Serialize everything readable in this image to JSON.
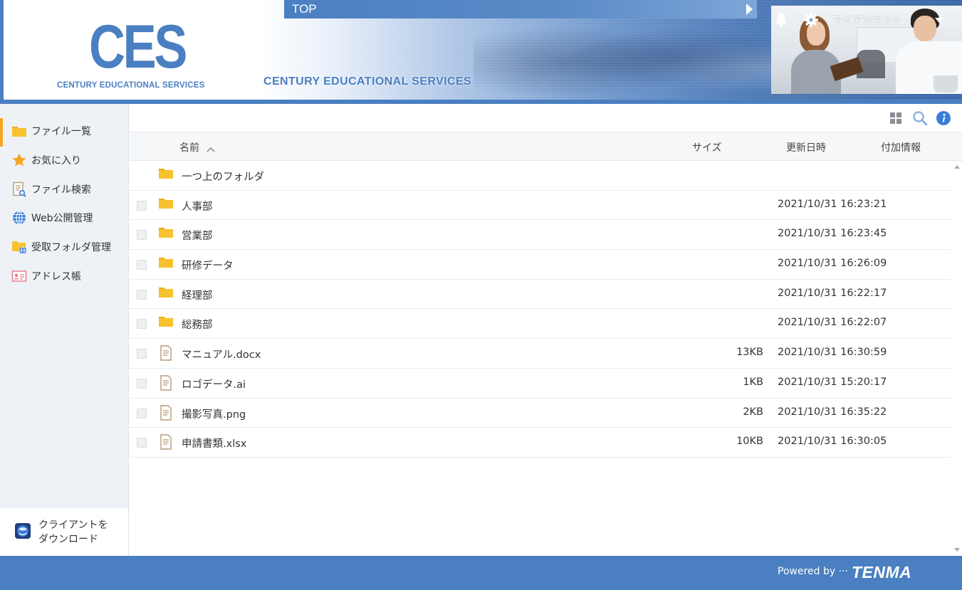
{
  "header": {
    "logo_text": "CES",
    "logo_subtitle": "CENTURY EDUCATIONAL SERVICES",
    "banner_title": "CENTURY EDUCATIONAL SERVICES",
    "breadcrumb": "TOP",
    "account_label": "マイアカウント"
  },
  "sidebar": {
    "items": [
      {
        "label": "ファイル一覧",
        "icon": "folder-icon"
      },
      {
        "label": "お気に入り",
        "icon": "star-icon"
      },
      {
        "label": "ファイル検索",
        "icon": "file-search-icon"
      },
      {
        "label": "Web公開管理",
        "icon": "globe-icon"
      },
      {
        "label": "受取フォルダ管理",
        "icon": "receive-folder-icon"
      },
      {
        "label": "アドレス帳",
        "icon": "address-book-icon"
      }
    ],
    "download_line1": "クライアントを",
    "download_line2": "ダウンロード"
  },
  "table": {
    "columns": {
      "name": "名前",
      "size": "サイズ",
      "modified": "更新日時",
      "info": "付加情報"
    },
    "parent_folder": "一つ上のフォルダ",
    "rows": [
      {
        "type": "folder",
        "name": "人事部",
        "size": "",
        "modified": "2021/10/31 16:23:21"
      },
      {
        "type": "folder",
        "name": "営業部",
        "size": "",
        "modified": "2021/10/31 16:23:45"
      },
      {
        "type": "folder",
        "name": "研修データ",
        "size": "",
        "modified": "2021/10/31 16:26:09"
      },
      {
        "type": "folder",
        "name": "経理部",
        "size": "",
        "modified": "2021/10/31 16:22:17"
      },
      {
        "type": "folder",
        "name": "総務部",
        "size": "",
        "modified": "2021/10/31 16:22:07"
      },
      {
        "type": "file",
        "name": "マニュアル.docx",
        "size": "13KB",
        "modified": "2021/10/31 16:30:59"
      },
      {
        "type": "file",
        "name": "ロゴデータ.ai",
        "size": "1KB",
        "modified": "2021/10/31 15:20:17"
      },
      {
        "type": "file",
        "name": "撮影写真.png",
        "size": "2KB",
        "modified": "2021/10/31 16:35:22"
      },
      {
        "type": "file",
        "name": "申請書類.xlsx",
        "size": "10KB",
        "modified": "2021/10/31 16:30:05"
      }
    ]
  },
  "footer": {
    "powered_by": "Powered by ···",
    "brand": "TENMA"
  },
  "colors": {
    "brand_blue": "#4a7fc1",
    "folder_yellow": "#f8c130",
    "active_accent": "#f5a623",
    "info_blue": "#3b7dd8"
  }
}
